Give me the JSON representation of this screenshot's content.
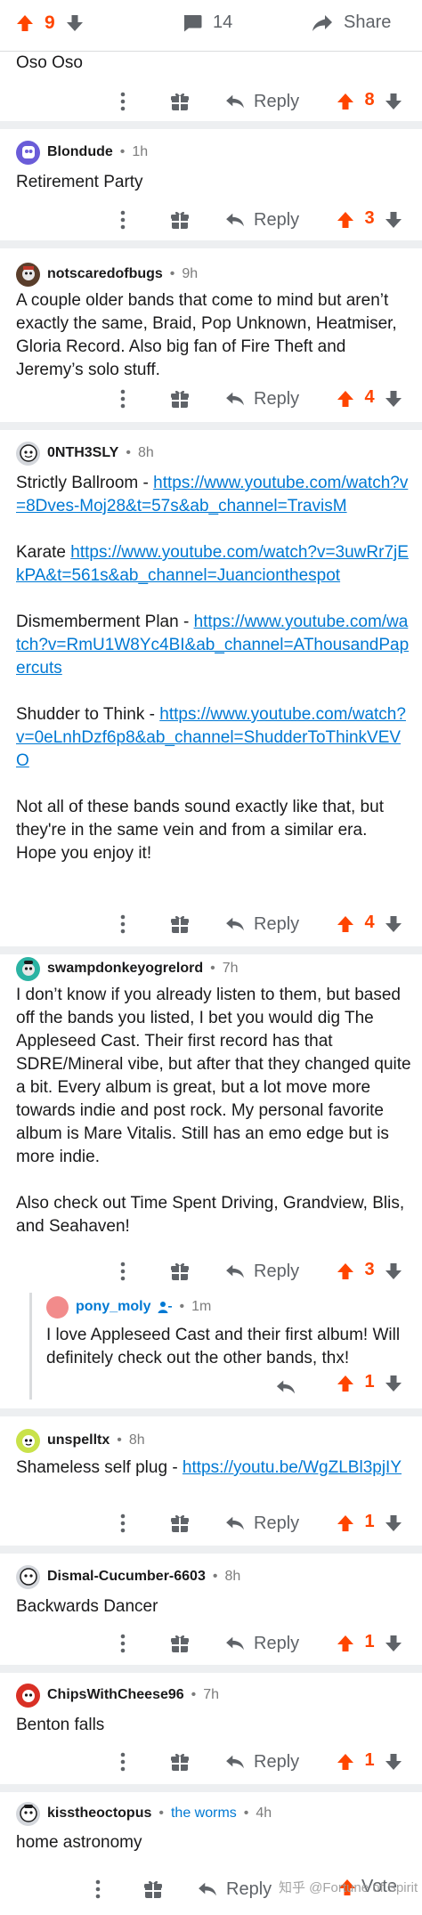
{
  "post_bar": {
    "score": "9",
    "comments": "14",
    "share_label": "Share"
  },
  "labels": {
    "reply": "Reply"
  },
  "comments": [
    {
      "body": [
        "Oso Oso"
      ],
      "score": "8"
    },
    {
      "user": "Blondude",
      "time": "1h",
      "body": [
        "Retirement Party"
      ],
      "score": "3"
    },
    {
      "user": "notscaredofbugs",
      "time": "9h",
      "body": [
        "A couple older bands that come to mind but aren’t exactly the same, Braid, Pop Unknown, Heatmiser, Gloria Record. Also big fan of Fire Theft and Jeremy’s solo stuff."
      ],
      "score": "4"
    },
    {
      "user": "0NTH3SLY",
      "time": "8h",
      "p1_text": "Strictly Ballroom - ",
      "p1_link": "https://www.youtube.com/watch?v=8Dves-Moj28&t=57s&ab_channel=TravisM",
      "p2_text": "Karate ",
      "p2_link": "https://www.youtube.com/watch?v=3uwRr7jEkPA&t=561s&ab_channel=Juancionthespot",
      "p3_text": "Dismemberment Plan - ",
      "p3_link": "https://www.youtube.com/watch?v=RmU1W8Yc4BI&ab_channel=AThousandPapercuts",
      "p4_text": "Shudder to Think - ",
      "p4_link": "https://www.youtube.com/watch?v=0eLnhDzf6p8&ab_channel=ShudderToThinkVEVO",
      "p5_text": "Not all of these bands sound exactly like that, but they're in the same vein and from a similar era. Hope you enjoy it!",
      "score": "4"
    },
    {
      "user": "swampdonkeyogrelord",
      "time": "7h",
      "p1_text": "I don’t know if you already listen to them, but based off the bands you listed, I bet you would dig The Appleseed Cast. Their first record has that SDRE/Mineral vibe, but after that they changed quite a bit. Every album is great, but a lot move more towards indie and post rock. My personal favorite album is Mare Vitalis. Still has an emo edge but is more indie.",
      "p2_text": "Also check out Time Spent Driving, Grandview, Blis, and Seahaven!",
      "score": "3"
    },
    {
      "user": "pony_moly",
      "time": "1m",
      "body": [
        "I love Appleseed Cast and their first album! Will definitely check out the other bands, thx!"
      ],
      "score": "1"
    },
    {
      "user": "unspelltx",
      "time": "8h",
      "p1_text": "Shameless self plug - ",
      "p1_link": "https://youtu.be/WgZLBl3pjIY",
      "score": "1"
    },
    {
      "user": "Dismal-Cucumber-6603",
      "time": "8h",
      "body": [
        "Backwards Dancer"
      ],
      "score": "1"
    },
    {
      "user": "ChipsWithCheese96",
      "time": "7h",
      "body": [
        "Benton falls"
      ],
      "score": "1"
    },
    {
      "user": "kisstheoctopus",
      "flair": "the worms",
      "time": "4h",
      "body": [
        "home astronomy"
      ],
      "vote_label": "Vote"
    }
  ],
  "watermark": "知乎 @Fortune of Spirit",
  "colors": {
    "upvote": "#ff4500",
    "link": "#0079d3",
    "separator": "#edeff1",
    "text": "#1a1a1b",
    "meta": "#7c7c7c"
  },
  "icons": [
    "upvote-arrow-icon",
    "downvote-arrow-icon",
    "comment-bubble-icon",
    "share-arrow-icon",
    "more-dots-icon",
    "award-gift-icon",
    "reply-arrow-icon",
    "user-avatar-icon",
    "op-person-icon"
  ]
}
